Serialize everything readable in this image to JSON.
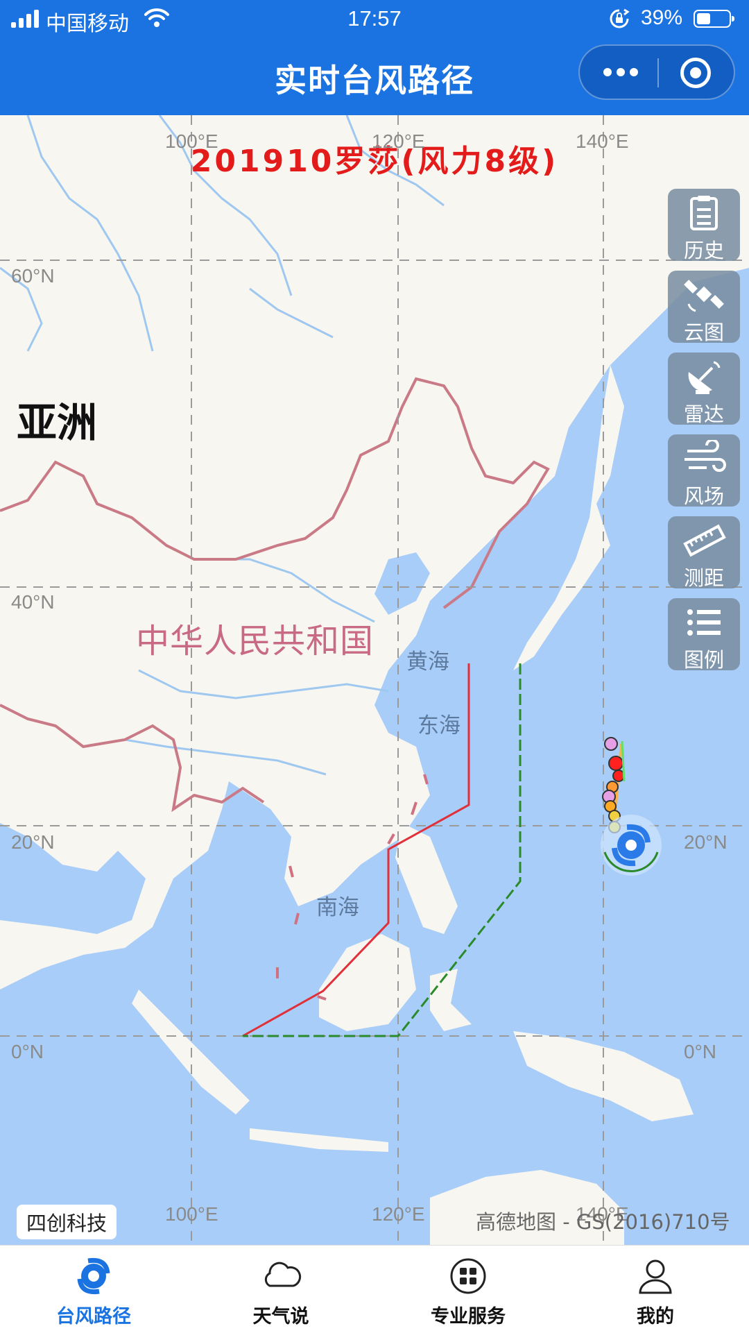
{
  "status_bar": {
    "carrier": "中国移动",
    "time": "17:57",
    "battery": "39%"
  },
  "nav": {
    "title": "实时台风路径"
  },
  "map": {
    "typhoon_title": "201910罗莎(风力8级)",
    "labels": {
      "lon_100_top": "100°E",
      "lon_120_top": "120°E",
      "lon_140_top": "140°E",
      "lon_100_bottom": "100°E",
      "lon_120_bottom": "120°E",
      "lon_140_bottom": "140°E",
      "lat_60_left": "60°N",
      "lat_40_left": "40°N",
      "lat_20_left": "20°N",
      "lat_0_left": "0°N",
      "lat_20_right": "20°N",
      "lat_0_right": "0°N"
    },
    "regions": {
      "asia": "亚洲",
      "china": "中华人民共和国",
      "yellow_sea": "黄海",
      "east_sea": "东海",
      "south_sea": "南海"
    },
    "brand": "四创科技",
    "attribution": "高德地图 - GS(2016)710号"
  },
  "sidebar": {
    "items": [
      {
        "label": "历史",
        "icon": "clipboard-icon"
      },
      {
        "label": "云图",
        "icon": "satellite-icon"
      },
      {
        "label": "雷达",
        "icon": "radar-dish-icon"
      },
      {
        "label": "风场",
        "icon": "wind-icon"
      },
      {
        "label": "测距",
        "icon": "ruler-icon"
      },
      {
        "label": "图例",
        "icon": "list-icon"
      }
    ]
  },
  "tabbar": {
    "items": [
      {
        "label": "台风路径",
        "icon": "typhoon-icon",
        "active": true
      },
      {
        "label": "天气说",
        "icon": "cloud-icon",
        "active": false
      },
      {
        "label": "专业服务",
        "icon": "grid-apps-icon",
        "active": false
      },
      {
        "label": "我的",
        "icon": "user-icon",
        "active": false
      }
    ]
  },
  "colors": {
    "accent": "#1a73e0",
    "typhoon_title": "#e31b1b",
    "warning_24h": "#e0303a",
    "warning_48h": "#2a8a2a",
    "sea": "#a8cdf8",
    "land": "#f8f6f0"
  }
}
